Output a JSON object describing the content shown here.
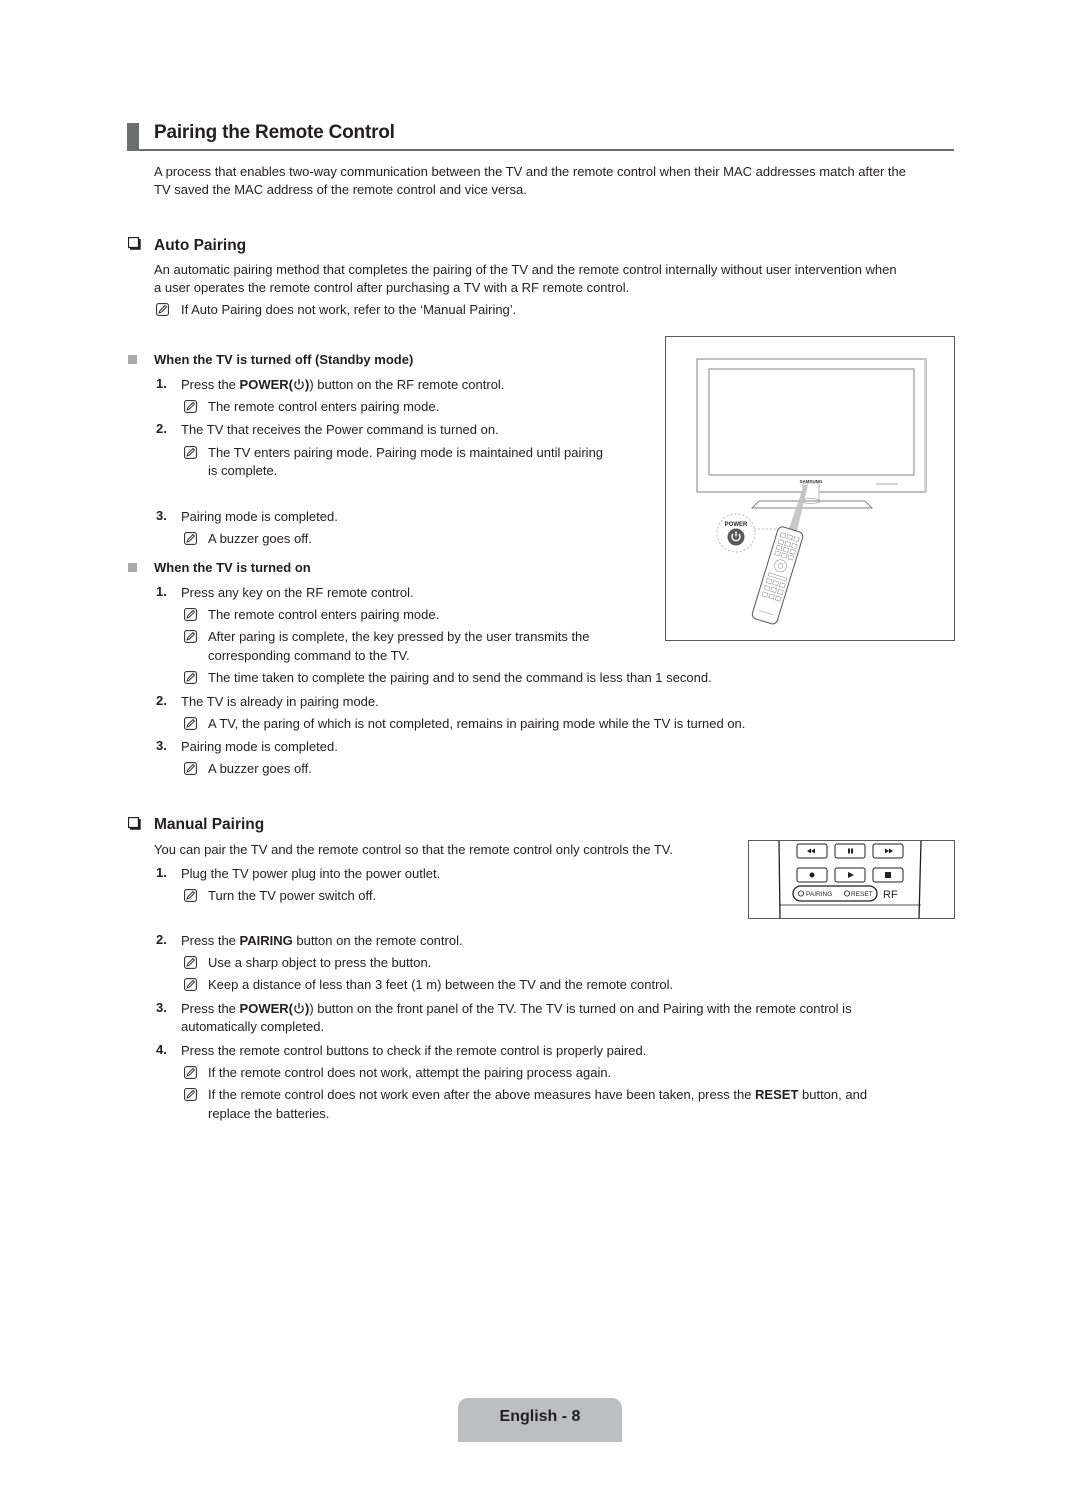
{
  "page": {
    "title": "Pairing the Remote Control",
    "intro": [
      "A process that enables two-way communication between the TV and the remote control when their MAC addresses match after the",
      "TV saved the MAC address of the remote control and vice versa."
    ],
    "note_icon": "note-pencil-icon",
    "power_icon": "power-icon"
  },
  "auto_pairing": {
    "heading": "Auto Pairing",
    "desc": [
      "An automatic pairing method that completes the pairing of the TV and the remote control internally without user intervention when",
      "a user operates the remote control after purchasing a TV with a RF remote control."
    ],
    "note": "If Auto Pairing does not work, refer to the ‘Manual Pairing’.",
    "standby": {
      "heading": "When the TV is turned off (Standby mode)",
      "steps": [
        {
          "num": "1.",
          "pre": "Press the ",
          "bold": "POWER(",
          "post": ") button on the RF remote control.",
          "notes": [
            "The remote control enters pairing mode."
          ]
        },
        {
          "num": "2.",
          "text": "The TV that receives the Power command is turned on.",
          "notes": [
            "The TV enters pairing mode. Pairing mode is maintained until pairing",
            "is complete."
          ]
        },
        {
          "num": "3.",
          "text": "Pairing mode is completed.",
          "notes": [
            "A buzzer goes off."
          ]
        }
      ]
    },
    "turned_on": {
      "heading": "When the TV is turned on",
      "steps": [
        {
          "num": "1.",
          "text": "Press any key on the RF remote control.",
          "notes": [
            "The remote control enters pairing mode.",
            "After paring is complete, the key pressed by the user transmits the",
            "corresponding command to the TV.",
            "The time taken to complete the pairing and to send the command is less than 1 second."
          ]
        },
        {
          "num": "2.",
          "text": "The TV is already in pairing mode.",
          "notes": [
            "A TV, the paring of which is not completed, remains in pairing mode while the TV is turned on."
          ]
        },
        {
          "num": "3.",
          "text": "Pairing mode is completed.",
          "notes": [
            "A buzzer goes off."
          ]
        }
      ]
    },
    "figure": {
      "brand": "SAMSUNG",
      "power_label": "POWER"
    }
  },
  "manual_pairing": {
    "heading": "Manual Pairing",
    "desc": "You can pair the TV and the remote control so that the remote control only controls the TV.",
    "steps": [
      {
        "num": "1.",
        "text": "Plug the TV power plug into the power outlet.",
        "notes": [
          "Turn the TV power switch off."
        ]
      },
      {
        "num": "2.",
        "pre": "Press the ",
        "bold": "PAIRING",
        "post": " button on the remote control.",
        "notes": [
          "Use a sharp object to press the button.",
          "Keep a distance of less than 3 feet (1 m) between the TV and the remote control."
        ]
      },
      {
        "num": "3.",
        "pre": "Press the ",
        "bold": "POWER(",
        "post": ") button on the front panel of the TV. The TV is turned on and Pairing with the remote control is",
        "cont": "automatically completed."
      },
      {
        "num": "4.",
        "text": "Press the remote control buttons to check if the remote control is properly paired.",
        "notes": [
          "If the remote control does not work, attempt the pairing process again.",
          "If the remote control does not work even after the above measures have been taken, press the ",
          "RESET",
          " button, and",
          "replace the batteries."
        ]
      }
    ],
    "figure": {
      "pairing_label": "PAIRING",
      "reset_label": "RESET",
      "rf_label": "RF",
      "buttons": [
        "rewind",
        "pause",
        "fast-forward",
        "record",
        "play",
        "stop"
      ]
    }
  },
  "footer": {
    "label": "English - 8"
  }
}
